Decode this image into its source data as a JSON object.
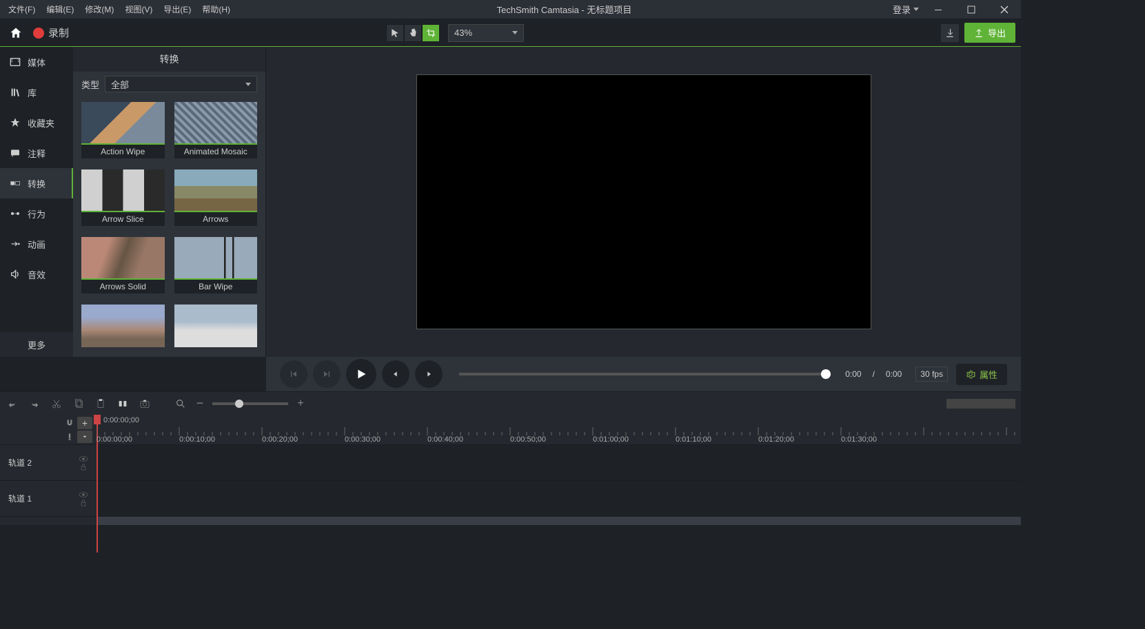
{
  "menu": {
    "file": "文件(F)",
    "edit": "编辑(E)",
    "modify": "修改(M)",
    "view": "视图(V)",
    "export": "导出(E)",
    "help": "帮助(H)"
  },
  "title": "TechSmith Camtasia - 无标题项目",
  "login": "登录",
  "record": "录制",
  "zoom": "43%",
  "export_btn": "导出",
  "sidebar": {
    "media": "媒体",
    "library": "库",
    "favorites": "收藏夹",
    "annotations": "注释",
    "transitions": "转换",
    "behaviors": "行为",
    "animations": "动画",
    "audio": "音效",
    "more": "更多"
  },
  "panel": {
    "title": "转换",
    "type_label": "类型",
    "type_value": "全部"
  },
  "transitions": [
    {
      "name": "Action Wipe"
    },
    {
      "name": "Animated Mosaic"
    },
    {
      "name": "Arrow Slice"
    },
    {
      "name": "Arrows"
    },
    {
      "name": "Arrows Solid"
    },
    {
      "name": "Bar Wipe"
    },
    {
      "name": ""
    },
    {
      "name": ""
    }
  ],
  "playback": {
    "current": "0:00",
    "total": "0:00",
    "fps": "30 fps",
    "sep": "/"
  },
  "properties": "属性",
  "timeline": {
    "current": "0:00:00;00",
    "marks": [
      "0:00:00;00",
      "0:00:10;00",
      "0:00:20;00",
      "0:00:30;00",
      "0:00:40;00",
      "0:00:50;00",
      "0:01:00;00",
      "0:01:10;00",
      "0:01:20;00",
      "0:01:30;00"
    ],
    "tracks": [
      "轨道 2",
      "轨道 1"
    ]
  }
}
